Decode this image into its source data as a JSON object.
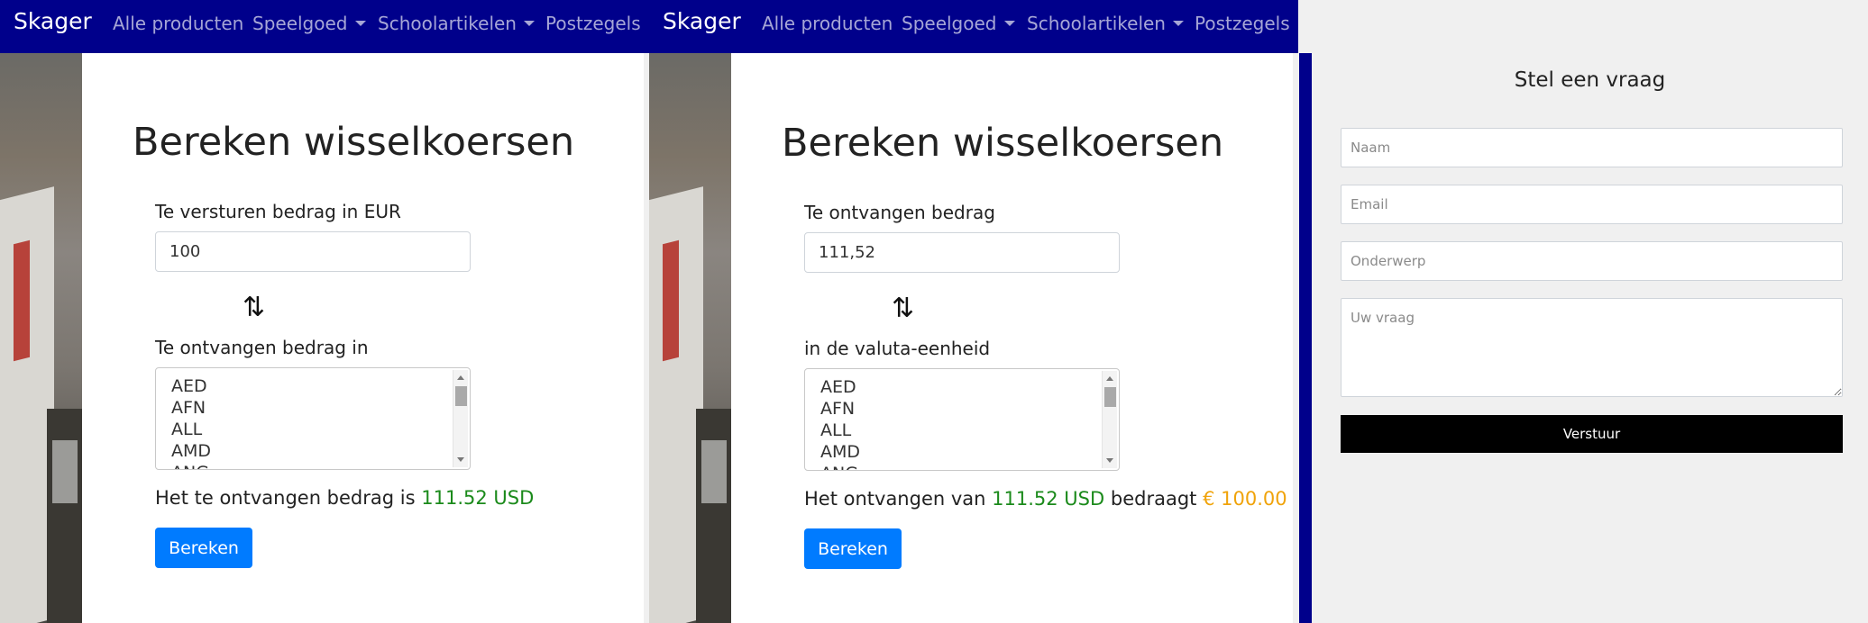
{
  "navbar": {
    "brand": "Skager",
    "items": [
      "Alle producten",
      "Speelgoed",
      "Schoolartikelen",
      "Postzegels"
    ]
  },
  "converter_send": {
    "title": "Bereken wisselkoersen",
    "amount_label": "Te versturen bedrag in EUR",
    "amount_value": "100",
    "currency_label": "Te ontvangen bedrag in",
    "currencies": [
      "AED",
      "AFN",
      "ALL",
      "AMD",
      "ANG"
    ],
    "result_prefix": "Het te ontvangen bedrag is",
    "result_value": "111.52 USD",
    "button": "Bereken"
  },
  "converter_receive": {
    "title": "Bereken wisselkoersen",
    "amount_label": "Te ontvangen bedrag",
    "amount_value": "111,52",
    "currency_label": "in de valuta-eenheid",
    "currencies": [
      "AED",
      "AFN",
      "ALL",
      "AMD",
      "ANG"
    ],
    "result_prefix": "Het ontvangen van",
    "result_value": "111.52 USD",
    "result_middle": "bedraagt",
    "result_eur": "€ 100.00",
    "button": "Bereken"
  },
  "contact_form": {
    "title": "Stel een vraag",
    "name_placeholder": "Naam",
    "email_placeholder": "Email",
    "subject_placeholder": "Onderwerp",
    "question_placeholder": "Uw vraag",
    "submit": "Verstuur"
  },
  "colors": {
    "navbar": "#00008b",
    "primary_button": "#007bff",
    "result_green": "#1b8a1b",
    "result_orange": "#f0a30a",
    "submit_button": "#000000"
  },
  "icons": [
    "swap-arrows-icon",
    "dropdown-caret-icon"
  ]
}
